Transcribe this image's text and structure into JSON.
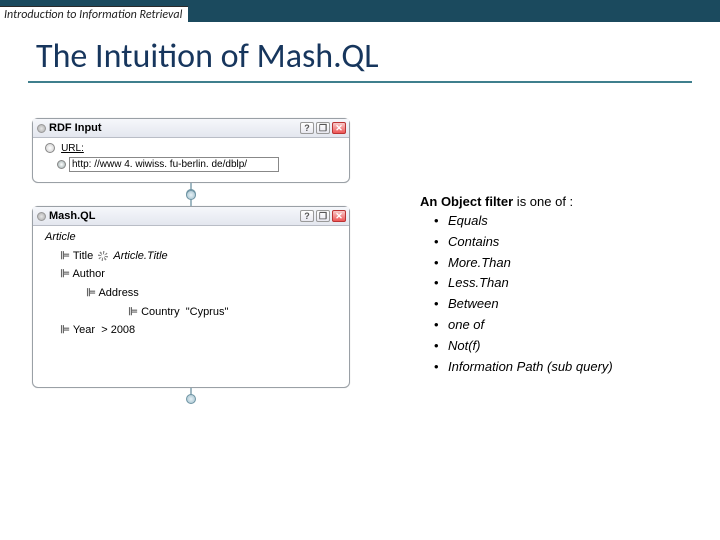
{
  "header": {
    "course": "Introduction to Information Retrieval"
  },
  "title": "The Intuition of Mash.QL",
  "rdf_panel": {
    "title": "RDF Input",
    "url_label": "URL:",
    "url_value": "http: //www 4. wiwiss. fu-berlin. de/dblp/"
  },
  "mashql_panel": {
    "title": "Mash.QL",
    "root": "Article",
    "rows": {
      "title_prop": "Title",
      "title_var": "Article.Title",
      "author_prop": "Author",
      "address_prop": "Address",
      "country_prop": "Country",
      "country_val": "\"Cyprus\"",
      "year_prop": "Year",
      "year_op": "> 2008"
    }
  },
  "side": {
    "lead_b": "An Object filter",
    "lead_rest": " is one of :",
    "items": [
      "Equals",
      "Contains",
      "More.Than",
      "Less.Than",
      "Between",
      "one of",
      "Not(f)",
      "Information Path (sub query)"
    ]
  }
}
